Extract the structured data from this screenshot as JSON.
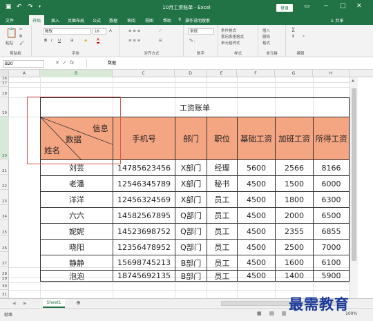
{
  "app": {
    "title": "10月工资账单 - Excel",
    "login": "登录",
    "quick_access": [
      "save",
      "undo",
      "redo"
    ]
  },
  "menu_tabs": [
    "文件",
    "开始",
    "插入",
    "页面布局",
    "公式",
    "数据",
    "审阅",
    "视图",
    "帮助",
    "操作说明搜索",
    "共享"
  ],
  "ribbon": {
    "groups": [
      {
        "label": "剪贴板",
        "items": [
          "粘贴"
        ]
      },
      {
        "label": "字体",
        "font_name": "微软",
        "font_size": "16",
        "items": [
          "B",
          "I",
          "U",
          "A"
        ]
      },
      {
        "label": "对齐方式",
        "items": []
      },
      {
        "label": "数字",
        "items": [
          "常规"
        ]
      },
      {
        "label": "样式",
        "items": [
          "条件格式",
          "套用表格格式",
          "单元格样式"
        ]
      },
      {
        "label": "单元格",
        "items": [
          "插入",
          "删除",
          "格式"
        ]
      },
      {
        "label": "编辑",
        "items": [
          "Σ"
        ]
      }
    ]
  },
  "formula_bar": {
    "name_box": "B20",
    "value": "数据"
  },
  "columns": [
    "A",
    "B",
    "C",
    "D",
    "E",
    "F",
    "G",
    "H"
  ],
  "rows": [
    "16",
    "17",
    "18",
    "19",
    "20",
    "21",
    "22",
    "23",
    "24",
    "25",
    "26",
    "27",
    "28",
    "29",
    "30",
    "31"
  ],
  "table": {
    "title": "工资账单",
    "diag_header": {
      "top": "信息",
      "middle": "数据",
      "bottom": "姓名"
    },
    "headers": [
      "手机号",
      "部门",
      "职位",
      "基础工资",
      "加班工资",
      "所得工资"
    ],
    "rows": [
      [
        "刘芸",
        "14785623456",
        "X部门",
        "经理",
        "5600",
        "2566",
        "8166"
      ],
      [
        "老潘",
        "12546345789",
        "X部门",
        "秘书",
        "4500",
        "1500",
        "6000"
      ],
      [
        "洋洋",
        "12456324569",
        "X部门",
        "员工",
        "4500",
        "1800",
        "6300"
      ],
      [
        "六六",
        "14582567895",
        "Q部门",
        "员工",
        "4500",
        "2000",
        "6500"
      ],
      [
        "妮妮",
        "14523698752",
        "Q部门",
        "员工",
        "4500",
        "2355",
        "6855"
      ],
      [
        "晓阳",
        "12356478952",
        "Q部门",
        "员工",
        "4500",
        "2500",
        "7000"
      ],
      [
        "静静",
        "15698745213",
        "B部门",
        "员工",
        "4500",
        "1600",
        "6100"
      ],
      [
        "泡泡",
        "18745692135",
        "B部门",
        "员工",
        "4500",
        "1400",
        "5900"
      ]
    ]
  },
  "sheet_tabs": [
    "Sheet1"
  ],
  "status": {
    "mode": "就绪",
    "zoom": "100%"
  },
  "watermark": "最需教育"
}
